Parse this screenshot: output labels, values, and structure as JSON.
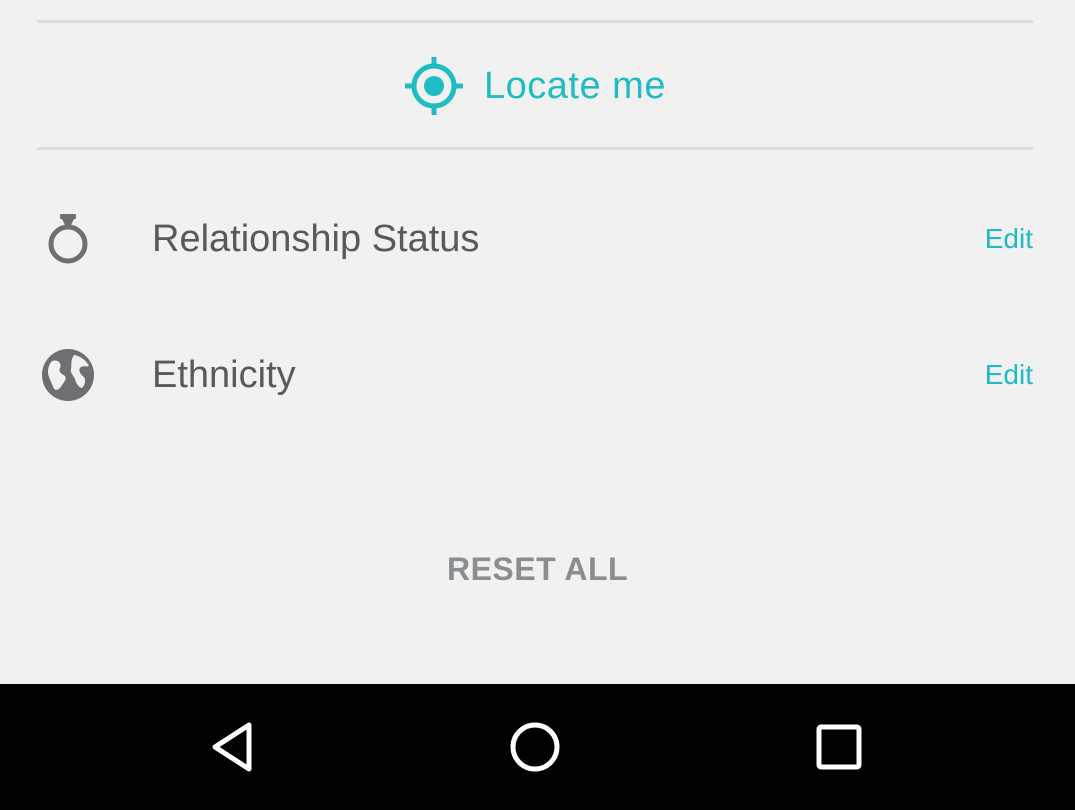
{
  "colors": {
    "accent": "#1fbcc4",
    "text": "#595959",
    "muted": "#8a8e91",
    "icon": "#6d6f72",
    "background": "#f1f1f1",
    "navbar": "#000000"
  },
  "locate": {
    "label": "Locate me",
    "icon": "crosshair-target-icon"
  },
  "rows": [
    {
      "icon": "ring-icon",
      "label": "Relationship Status",
      "action": "Edit"
    },
    {
      "icon": "globe-icon",
      "label": "Ethnicity",
      "action": "Edit"
    }
  ],
  "reset": {
    "label": "RESET ALL"
  },
  "navbar": {
    "buttons": [
      "back-icon",
      "home-icon",
      "recents-icon"
    ]
  }
}
